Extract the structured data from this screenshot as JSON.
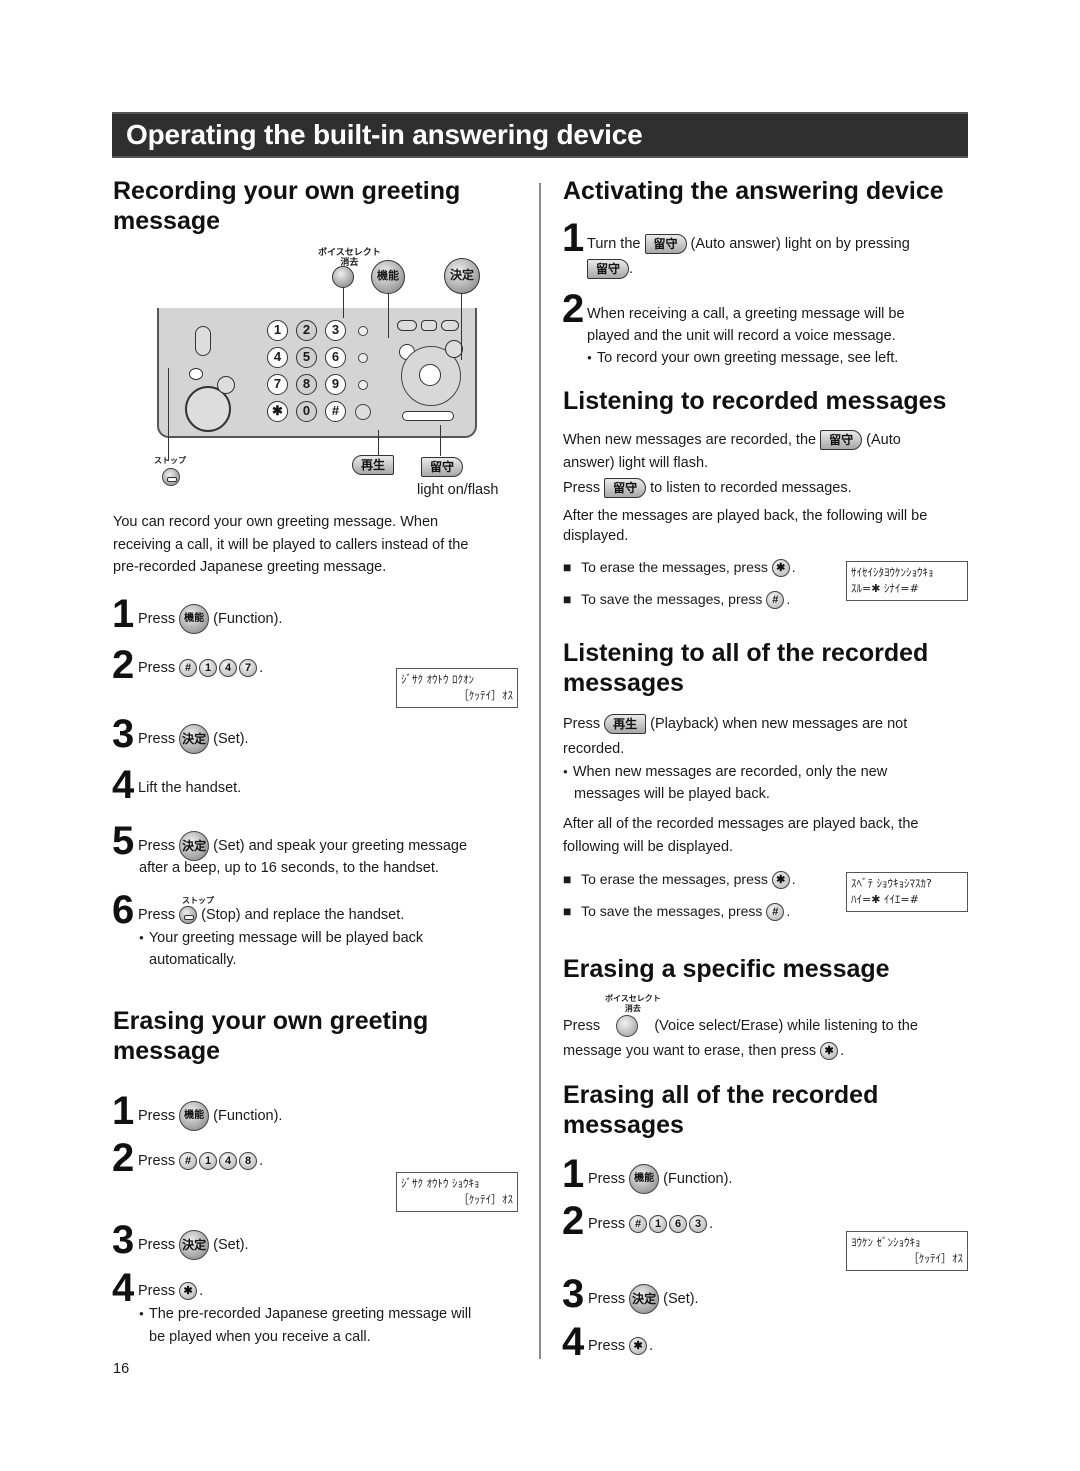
{
  "page": {
    "title": "Operating the built-in answering device",
    "page_number": "16"
  },
  "icons": {
    "function_btn": "機能",
    "set_btn": "決定",
    "auto_answer_btn": "留守",
    "playback_btn": "再生",
    "stop_label": "ストップ",
    "voice_select_label_top": "ボイスセレクト",
    "voice_select_label_bottom": "消去",
    "key_hash": "#",
    "key_star": "✱"
  },
  "diagram": {
    "keys": [
      "1",
      "2",
      "3",
      "4",
      "5",
      "6",
      "7",
      "8",
      "9",
      "✱",
      "0",
      "#"
    ],
    "light_caption": "light on/flash"
  },
  "left": {
    "recording": {
      "heading_line1": "Recording your own greeting",
      "heading_line2": "message",
      "intro": [
        "You can record your own greeting message. When",
        "receiving a call, it will be played to callers instead of the",
        "pre-recorded Japanese greeting message."
      ],
      "steps": [
        {
          "num": "1",
          "pre": "Press",
          "post": "(Function)."
        },
        {
          "num": "2",
          "pre": "Press",
          "keys": [
            "#",
            "1",
            "4",
            "7"
          ],
          "post": "."
        },
        {
          "num": "3",
          "pre": "Press",
          "post": "(Set)."
        },
        {
          "num": "4",
          "text": "Lift the handset."
        },
        {
          "num": "5",
          "pre": "Press",
          "post": "(Set) and speak your greeting message",
          "line2": "after a beep, up to 16 seconds, to the handset."
        },
        {
          "num": "6",
          "pre": "Press",
          "post": "(Stop) and replace the handset.",
          "bullet1": "Your greeting message will be played back",
          "bullet2": "automatically."
        }
      ],
      "lcd": {
        "line1": "ｼﾞｻｸ ｵｳﾄｳ ﾛｸｵﾝ",
        "line2": "［ｹｯﾃｲ］ｵｽ"
      }
    },
    "erasing": {
      "heading_line1": "Erasing your own greeting",
      "heading_line2": "message",
      "steps": [
        {
          "num": "1",
          "pre": "Press",
          "post": "(Function)."
        },
        {
          "num": "2",
          "pre": "Press",
          "keys": [
            "#",
            "1",
            "4",
            "8"
          ],
          "post": "."
        },
        {
          "num": "3",
          "pre": "Press",
          "post": "(Set)."
        },
        {
          "num": "4",
          "pre": "Press",
          "post": ".",
          "bullet1": "The pre-recorded Japanese greeting message will",
          "bullet2": "be played when you receive a call."
        }
      ],
      "lcd": {
        "line1": "ｼﾞｻｸ ｵｳﾄｳ ｼｮｳｷｮ",
        "line2": "［ｹｯﾃｲ］ｵｽ"
      }
    }
  },
  "right": {
    "activating": {
      "heading": "Activating the answering device",
      "step1_pre": "Turn the",
      "step1_post": "(Auto answer) light on by pressing",
      "step2_line1": "When receiving a call, a greeting message will be",
      "step2_line2": "played and the unit will record a voice message.",
      "step2_bullet": "To record your own greeting message, see left."
    },
    "listening": {
      "heading": "Listening to recorded messages",
      "p1_pre": "When new messages are recorded, the",
      "p1_post": "(Auto",
      "p1_line2": "answer) light will flash.",
      "p2_pre": "Press",
      "p2_post": "to listen to recorded messages.",
      "p3_line1": "After the messages are played back, the following will be",
      "p3_line2": "displayed.",
      "erase": "To erase the messages, press",
      "save": "To save the messages, press",
      "lcd": {
        "line1": "ｻｲｾｲｼﾀﾖｳｹﾝｼｮｳｷｮ",
        "line2": "ｽﾙ=✱ ｼﾅｲ=#"
      }
    },
    "listening_all": {
      "heading_line1": "Listening to all of the recorded",
      "heading_line2": "messages",
      "p1_pre": "Press",
      "p1_post": "(Playback) when new messages are not",
      "p1_line2": "recorded.",
      "bullet_line1": "When new messages are recorded, only the new",
      "bullet_line2": "messages will be played back.",
      "p2_line1": "After all of the recorded messages are played back, the",
      "p2_line2": "following will be displayed.",
      "erase": "To erase the messages, press",
      "save": "To save the messages, press",
      "lcd": {
        "line1": "ｽﾍﾞﾃ ｼｮｳｷｮｼﾏｽｶ?",
        "line2": "ﾊｲ=✱ ｲｲｴ=#"
      }
    },
    "erasing_specific": {
      "heading": "Erasing a specific message",
      "pre": "Press",
      "post": "(Voice select/Erase) while listening to the",
      "line2": "message you want to erase, then press"
    },
    "erasing_all": {
      "heading_line1": "Erasing all of the recorded",
      "heading_line2": "messages",
      "steps": [
        {
          "num": "1",
          "pre": "Press",
          "post": "(Function)."
        },
        {
          "num": "2",
          "pre": "Press",
          "keys": [
            "#",
            "1",
            "6",
            "3"
          ],
          "post": "."
        },
        {
          "num": "3",
          "pre": "Press",
          "post": "(Set)."
        },
        {
          "num": "4",
          "pre": "Press",
          "post": "."
        }
      ],
      "lcd": {
        "line1": "ﾖｳｹﾝ ｾﾞﾝｼｮｳｷｮ",
        "line2": "［ｹｯﾃｲ］ｵｽ"
      }
    }
  }
}
